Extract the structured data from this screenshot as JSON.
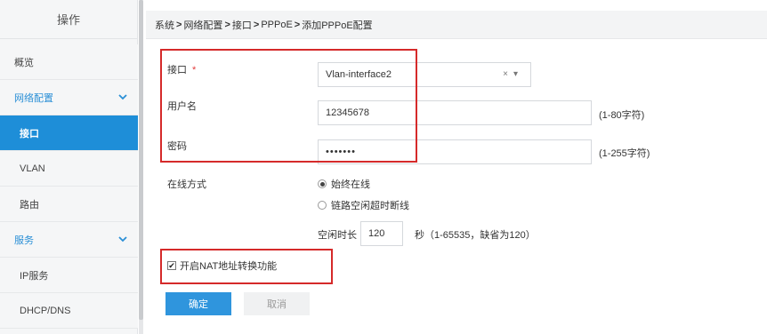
{
  "sidebar": {
    "header": "操作",
    "items": [
      {
        "label": "概览"
      },
      {
        "label": "网络配置"
      },
      {
        "label": "接口"
      },
      {
        "label": "VLAN"
      },
      {
        "label": "路由"
      },
      {
        "label": "服务"
      },
      {
        "label": "IP服务"
      },
      {
        "label": "DHCP/DNS"
      }
    ]
  },
  "breadcrumb": [
    "系统",
    "网络配置",
    "接口",
    "PPPoE",
    "添加PPPoE配置"
  ],
  "breadcrumb_sep": ">",
  "form": {
    "interface": {
      "label": "接口",
      "required_mark": "*",
      "value": "Vlan-interface2",
      "clear": "×",
      "arrow": "▾"
    },
    "username": {
      "label": "用户名",
      "value": "12345678",
      "hint": "(1-80字符)"
    },
    "password": {
      "label": "密码",
      "value": "•••••••",
      "hint": "(1-255字符)"
    },
    "online_mode": {
      "label": "在线方式",
      "options": [
        {
          "label": "始终在线",
          "selected": true
        },
        {
          "label": "链路空闲超时断线",
          "selected": false
        }
      ]
    },
    "idle": {
      "prefix": "空闲时长",
      "value": "120",
      "suffix": "秒（1-65535，缺省为120）"
    },
    "nat": {
      "label": "开启NAT地址转换功能",
      "checked": true,
      "checkmark": "✔"
    },
    "ok_label": "确定",
    "cancel_label": "取消"
  },
  "colors": {
    "accent": "#1e8ed8",
    "highlight": "#d52a2a"
  }
}
